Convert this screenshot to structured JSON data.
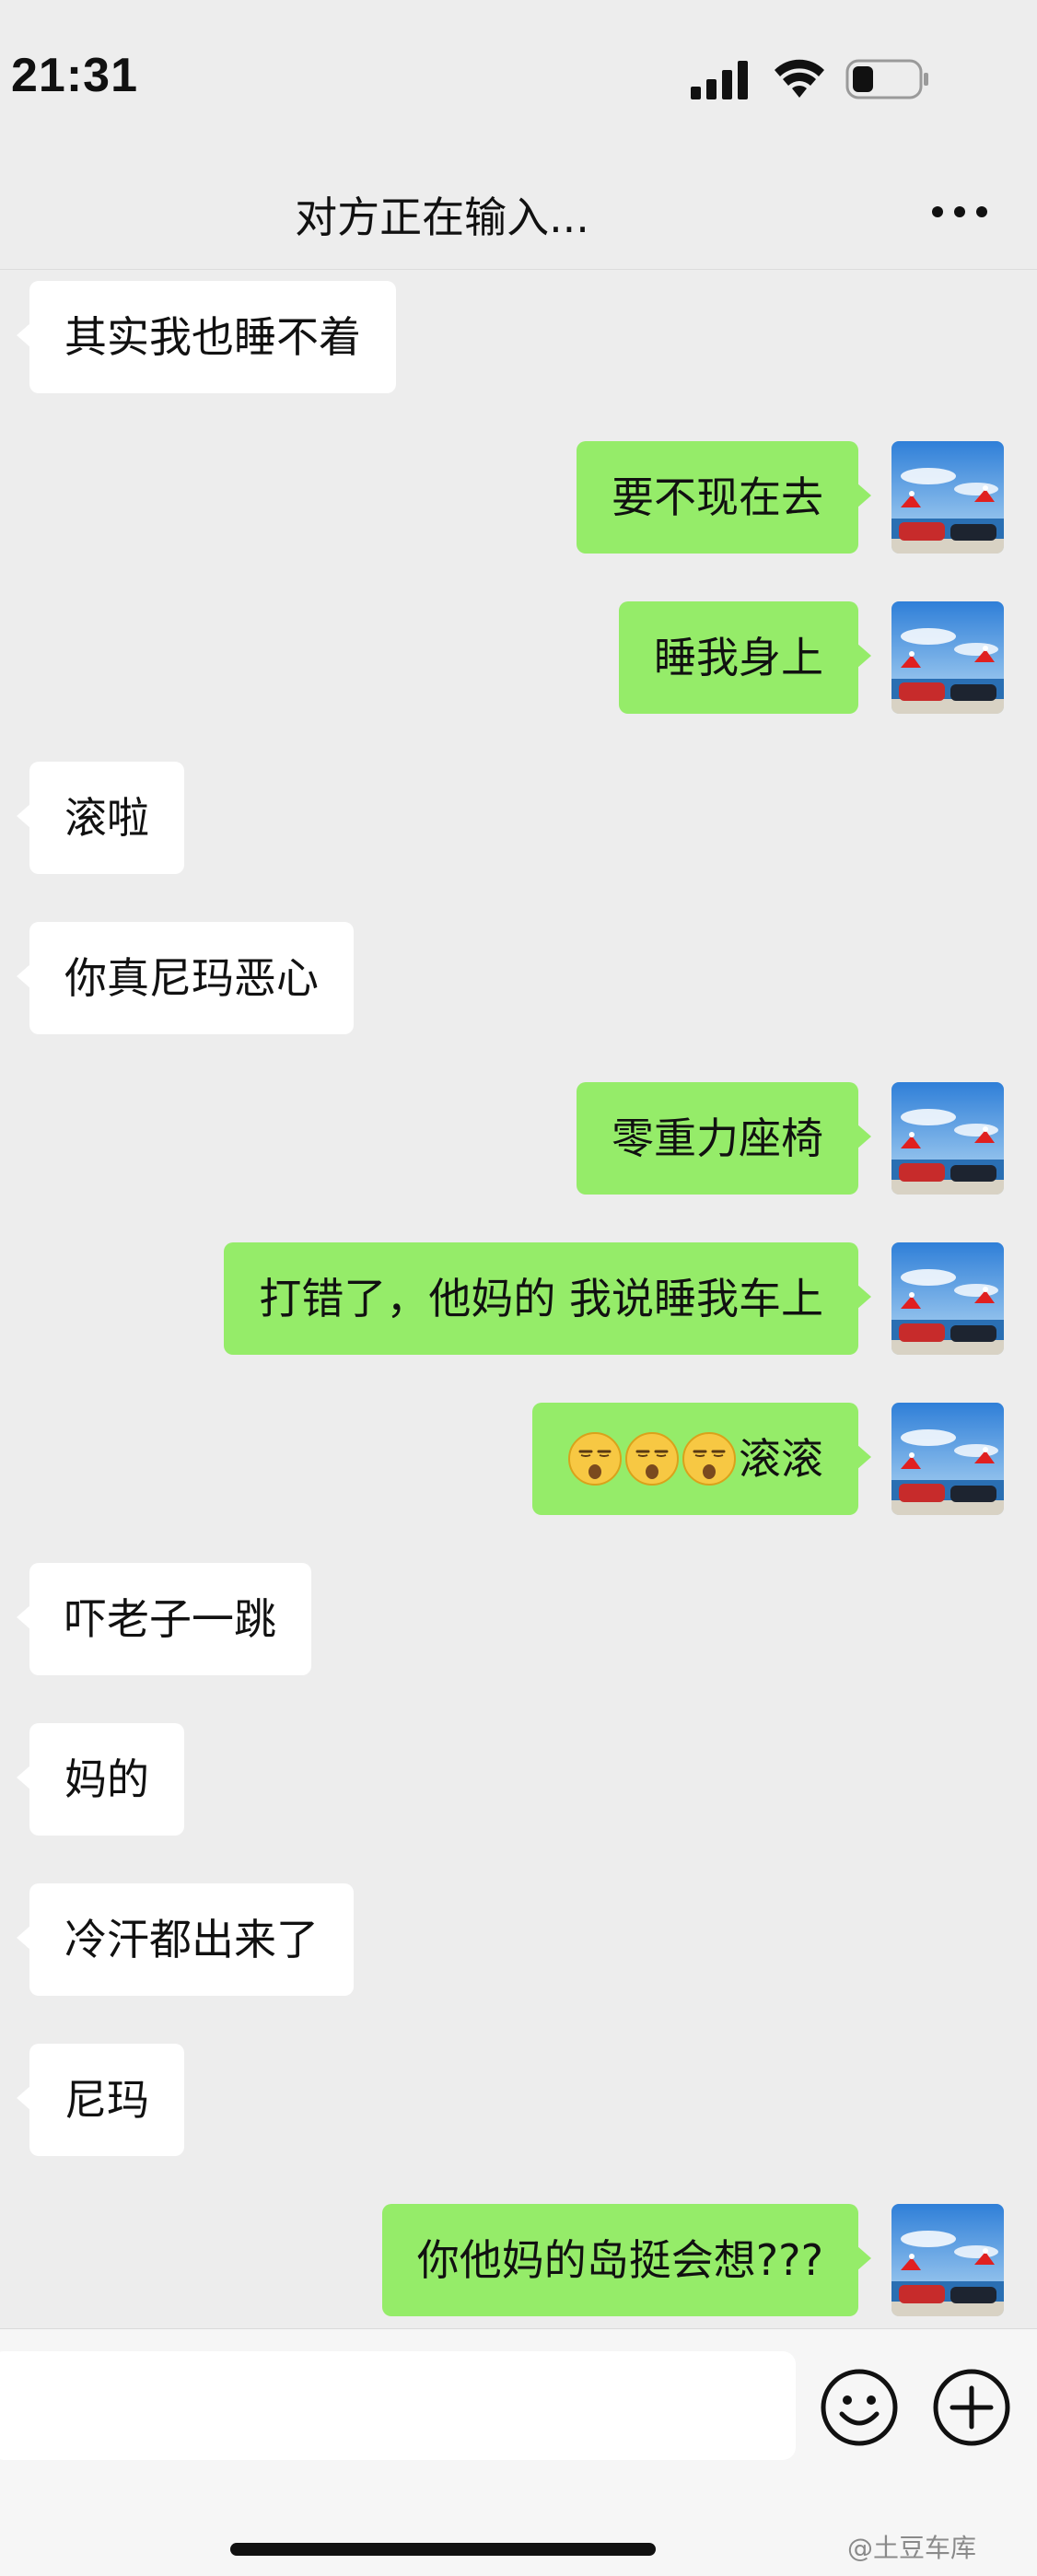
{
  "status_bar": {
    "time": "21:31",
    "icons": [
      "cellular-signal-icon",
      "wifi-icon",
      "battery-icon"
    ]
  },
  "nav": {
    "title": "对方正在输入...",
    "more_icon": "more-dots-icon"
  },
  "messages": [
    {
      "side": "left",
      "text": "其实我也睡不着"
    },
    {
      "side": "right",
      "text": "要不现在去"
    },
    {
      "side": "right",
      "text": "睡我身上"
    },
    {
      "side": "left",
      "text": "滚啦"
    },
    {
      "side": "left",
      "text": "你真尼玛恶心"
    },
    {
      "side": "right",
      "text": "零重力座椅"
    },
    {
      "side": "right",
      "text": "打错了，他妈的 我说睡我车上"
    },
    {
      "side": "right",
      "text": "滚滚",
      "emojis": [
        "unamused-emoji",
        "unamused-emoji",
        "unamused-emoji"
      ]
    },
    {
      "side": "left",
      "text": "吓老子一跳"
    },
    {
      "side": "left",
      "text": "妈的"
    },
    {
      "side": "left",
      "text": "冷汗都出来了"
    },
    {
      "side": "left",
      "text": "尼玛"
    },
    {
      "side": "right",
      "text": "你他妈的岛挺会想???"
    }
  ],
  "input_bar": {
    "placeholder": "",
    "emoji_icon": "smiley-face-icon",
    "add_icon": "plus-circle-icon"
  },
  "watermark": "@土豆车库",
  "colors": {
    "background": "#EDEDED",
    "sent_bubble": "#95EC69",
    "received_bubble": "#FFFFFF"
  }
}
